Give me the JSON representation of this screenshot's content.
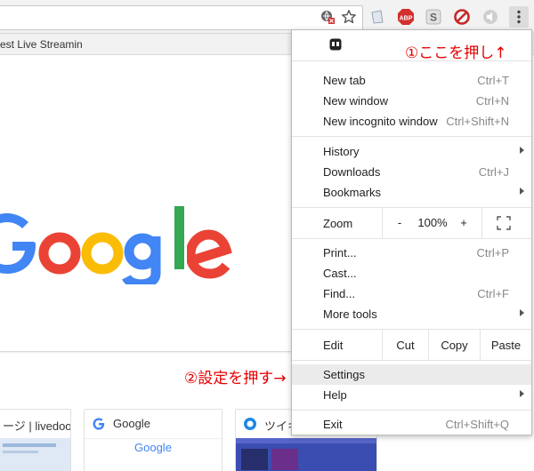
{
  "browser": {
    "bookmark_item": "est Live Streamin"
  },
  "extensions": {
    "abp_label": "ABP",
    "s_label": "S"
  },
  "page": {
    "tiles": [
      {
        "title": "ージ | livedoo"
      },
      {
        "title": "Google",
        "thumb_logo": "Google"
      },
      {
        "title": "ツイキ"
      }
    ]
  },
  "menu": {
    "new_tab": {
      "label": "New tab",
      "shortcut": "Ctrl+T"
    },
    "new_window": {
      "label": "New window",
      "shortcut": "Ctrl+N"
    },
    "new_incognito": {
      "label": "New incognito window",
      "shortcut": "Ctrl+Shift+N"
    },
    "history": {
      "label": "History"
    },
    "downloads": {
      "label": "Downloads",
      "shortcut": "Ctrl+J"
    },
    "bookmarks": {
      "label": "Bookmarks"
    },
    "zoom": {
      "label": "Zoom",
      "minus": "-",
      "value": "100%",
      "plus": "+"
    },
    "print": {
      "label": "Print...",
      "shortcut": "Ctrl+P"
    },
    "cast": {
      "label": "Cast..."
    },
    "find": {
      "label": "Find...",
      "shortcut": "Ctrl+F"
    },
    "more_tools": {
      "label": "More tools"
    },
    "edit": {
      "label": "Edit",
      "cut": "Cut",
      "copy": "Copy",
      "paste": "Paste"
    },
    "settings": {
      "label": "Settings"
    },
    "help": {
      "label": "Help"
    },
    "exit": {
      "label": "Exit",
      "shortcut": "Ctrl+Shift+Q"
    }
  },
  "annotations": {
    "step1": "①ここを押し↑",
    "step2": "②設定を押す→"
  },
  "colors": {
    "google_blue": "#4285F4",
    "google_red": "#EA4335",
    "google_yellow": "#FBBC05",
    "google_green": "#34A853",
    "annotation_red": "#e60000",
    "abp_red": "#d32f2f"
  }
}
